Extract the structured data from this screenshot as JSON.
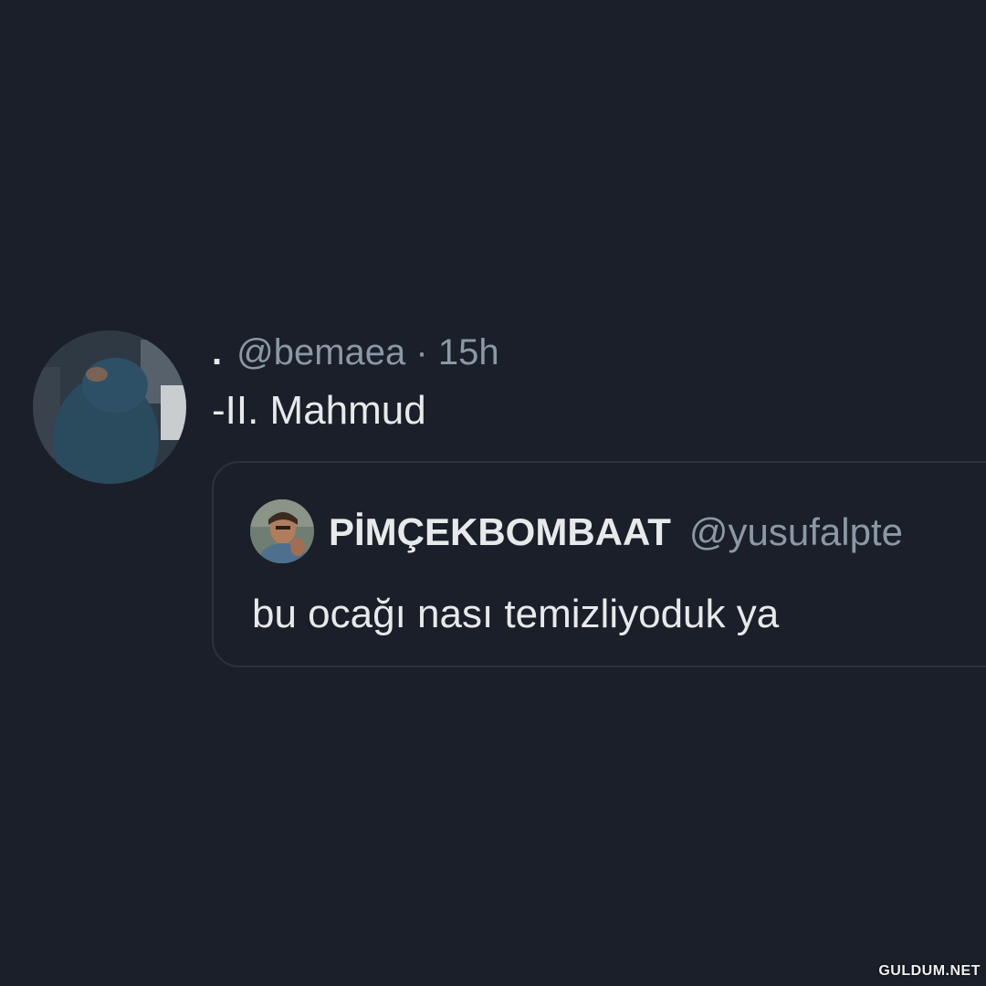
{
  "tweet": {
    "display_name": ".",
    "handle": "@bemaea",
    "separator": "·",
    "time": "15h",
    "text": "-II. Mahmud"
  },
  "quote": {
    "display_name": "PİMÇEKBOMBAAT",
    "handle": "@yusufalpte",
    "text": "bu ocağı nası temizliyoduk ya"
  },
  "watermark": "GULDUM.NET",
  "colors": {
    "background": "#1a1f2a",
    "primary_text": "#e7e9ea",
    "secondary_text": "#8b98a5",
    "card_border": "#2b323c"
  }
}
